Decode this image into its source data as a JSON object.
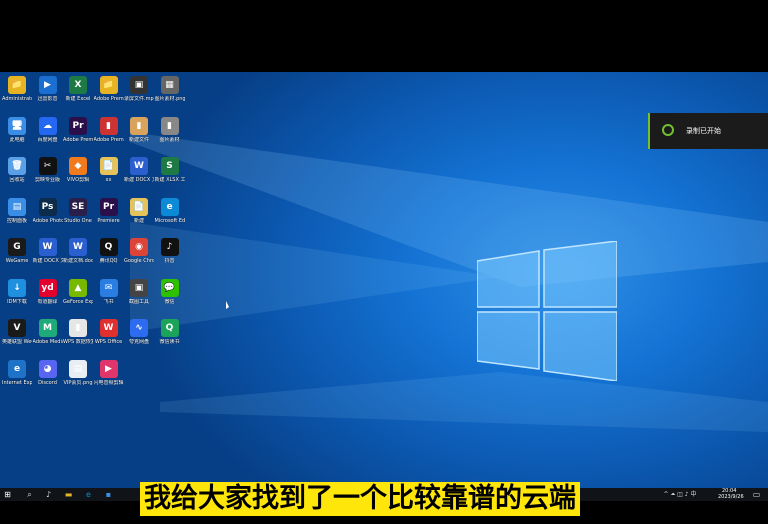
{
  "notification": {
    "text": "录制已开始"
  },
  "subtitle": "我给大家找到了一个比较靠谱的云端",
  "taskbar": {
    "time": "20:04",
    "date": "2023/9/26",
    "ime": "中"
  },
  "colors": {
    "desktop": "#1473d4",
    "notify_accent": "#73c12d",
    "subtitle_bg": "#ffe60a"
  },
  "icons": [
    {
      "label": "Administrator",
      "glyph": "📁",
      "color": "#e6b422"
    },
    {
      "label": "迅雷影音",
      "glyph": "▶",
      "color": "#1b6fd1"
    },
    {
      "label": "新建 Excel",
      "glyph": "X",
      "color": "#1d7a45"
    },
    {
      "label": "Adobe Premiere",
      "glyph": "📁",
      "color": "#e6b422"
    },
    {
      "label": "录屏文件.mp4",
      "glyph": "▣",
      "color": "#333333"
    },
    {
      "label": "图片素材.png",
      "glyph": "▦",
      "color": "#666666"
    },
    {
      "label": "此电脑",
      "glyph": "🖥",
      "color": "#3a8ee6"
    },
    {
      "label": "百度网盘",
      "glyph": "☁",
      "color": "#2468f2"
    },
    {
      "label": "Adobe Premiere",
      "glyph": "Pr",
      "color": "#2a0f4a"
    },
    {
      "label": "Adobe Premiere",
      "glyph": "▮",
      "color": "#c33"
    },
    {
      "label": "新建文件",
      "glyph": "▮",
      "color": "#d9a35b"
    },
    {
      "label": "图片素材",
      "glyph": "▮",
      "color": "#888888"
    },
    {
      "label": "回收站",
      "glyph": "🗑",
      "color": "#5aa0e6"
    },
    {
      "label": "剪映专业版",
      "glyph": "✂",
      "color": "#111111"
    },
    {
      "label": "VIVO剪辑",
      "glyph": "◆",
      "color": "#f07a1c"
    },
    {
      "label": "xx",
      "glyph": "📄",
      "color": "#e6c25a"
    },
    {
      "label": "新建 DOCX 文档.docx",
      "glyph": "W",
      "color": "#2b5fcf"
    },
    {
      "label": "新建 XLSX 工作表.xlsx",
      "glyph": "S",
      "color": "#1d7a45"
    },
    {
      "label": "控制面板",
      "glyph": "▤",
      "color": "#3a8ee6"
    },
    {
      "label": "Adobe Photoshop",
      "glyph": "Ps",
      "color": "#0d2b4a"
    },
    {
      "label": "Studio One",
      "glyph": "SE",
      "color": "#2a1f4a"
    },
    {
      "label": "Premiere",
      "glyph": "Pr",
      "color": "#2a0f4a"
    },
    {
      "label": "新建",
      "glyph": "📄",
      "color": "#e6c25a"
    },
    {
      "label": "Microsoft Edge",
      "glyph": "e",
      "color": "#0c8ad6"
    },
    {
      "label": "WeGame",
      "glyph": "G",
      "color": "#1a1a1a"
    },
    {
      "label": "新建 DOCX 文档.docx",
      "glyph": "W",
      "color": "#2b5fcf"
    },
    {
      "label": "新建文档.docx",
      "glyph": "W",
      "color": "#2b5fcf"
    },
    {
      "label": "腾讯QQ",
      "glyph": "Q",
      "color": "#111111"
    },
    {
      "label": "Google Chrome",
      "glyph": "◉",
      "color": "#db4437"
    },
    {
      "label": "抖音",
      "glyph": "♪",
      "color": "#111111"
    },
    {
      "label": "IDM下载",
      "glyph": "↓",
      "color": "#1f8fe0"
    },
    {
      "label": "有道翻译",
      "glyph": "yd",
      "color": "#e3002d"
    },
    {
      "label": "GeForce Experience",
      "glyph": "▲",
      "color": "#76b900"
    },
    {
      "label": "飞书",
      "glyph": "✉",
      "color": "#2a7de1"
    },
    {
      "label": "截图工具",
      "glyph": "▣",
      "color": "#444444"
    },
    {
      "label": "微信",
      "glyph": "💬",
      "color": "#2dc100"
    },
    {
      "label": "英雄联盟 WeGame版",
      "glyph": "V",
      "color": "#1a1a1a"
    },
    {
      "label": "Adobe Media Encoder",
      "glyph": "M",
      "color": "#1faa7a"
    },
    {
      "label": "WPS 数据恢复工具",
      "glyph": "▮",
      "color": "#e6e6e6"
    },
    {
      "label": "WPS Office",
      "glyph": "W",
      "color": "#e02f2f"
    },
    {
      "label": "夸克网盘",
      "glyph": "∿",
      "color": "#2d6bf0"
    },
    {
      "label": "微信读书",
      "glyph": "Q",
      "color": "#1ca35a"
    },
    {
      "label": "Internet Explorer",
      "glyph": "e",
      "color": "#1e73c8"
    },
    {
      "label": "Discord",
      "glyph": "◕",
      "color": "#5865f2"
    },
    {
      "label": "VIP会员.png",
      "glyph": "▤",
      "color": "#e9eef5"
    },
    {
      "label": "闪电音频剪辑",
      "glyph": "▶",
      "color": "#e0356b"
    }
  ]
}
